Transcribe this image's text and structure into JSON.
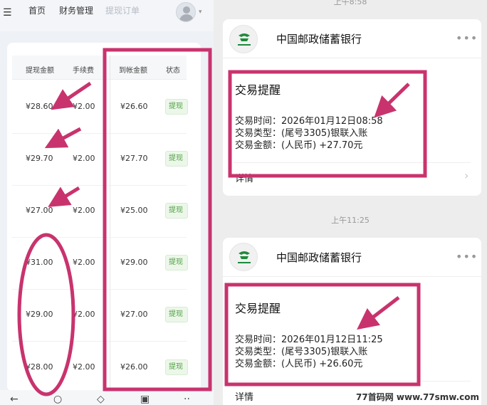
{
  "left_app": {
    "nav": {
      "items": [
        "首页",
        "财务管理",
        "提现订单"
      ]
    },
    "table": {
      "headers": [
        "提现金额",
        "手续费",
        "到帐金额",
        "状态"
      ],
      "rows": [
        {
          "amount": "¥28.60",
          "fee": "¥2.00",
          "received": "¥26.60",
          "status": "提现"
        },
        {
          "amount": "¥29.70",
          "fee": "¥2.00",
          "received": "¥27.70",
          "status": "提现"
        },
        {
          "amount": "¥27.00",
          "fee": "¥2.00",
          "received": "¥25.00",
          "status": "提现"
        },
        {
          "amount": "¥31.00",
          "fee": "¥2.00",
          "received": "¥29.00",
          "status": "提现"
        },
        {
          "amount": "¥29.00",
          "fee": "¥2.00",
          "received": "¥27.00",
          "status": "提现"
        },
        {
          "amount": "¥28.00",
          "fee": "¥2.00",
          "received": "¥26.00",
          "status": "提现"
        }
      ],
      "status_color": "#52a044"
    }
  },
  "right_app": {
    "messages": [
      {
        "timestamp": "上午8:58",
        "bank_name": "中国邮政储蓄银行",
        "title": "交易提醒",
        "lines": [
          "交易时间：2026年01月12日08:58",
          "交易类型：(尾号3305)银联入账",
          "交易金额：(人民币) +27.70元"
        ],
        "details": "详情"
      },
      {
        "timestamp": "上午11:25",
        "bank_name": "中国邮政储蓄银行",
        "title": "交易提醒",
        "lines": [
          "交易时间：2026年01月12日11:25",
          "交易类型：(尾号3305)银联入账",
          "交易金额：(人民币) +26.60元"
        ],
        "details": "详情"
      }
    ],
    "watermark": {
      "brand": "77首码网",
      "url": "www.77smw.com"
    }
  },
  "icons": {
    "menu": "menu-icon",
    "avatar": "user-avatar-icon",
    "more": "more-dots-icon",
    "chevron": "chevron-right-icon",
    "bottom_bar": [
      "back-icon",
      "search-icon",
      "home-icon",
      "bag-icon",
      "more-icon"
    ]
  },
  "colors": {
    "annotation": "#c8336e",
    "status_green": "#52a044"
  }
}
